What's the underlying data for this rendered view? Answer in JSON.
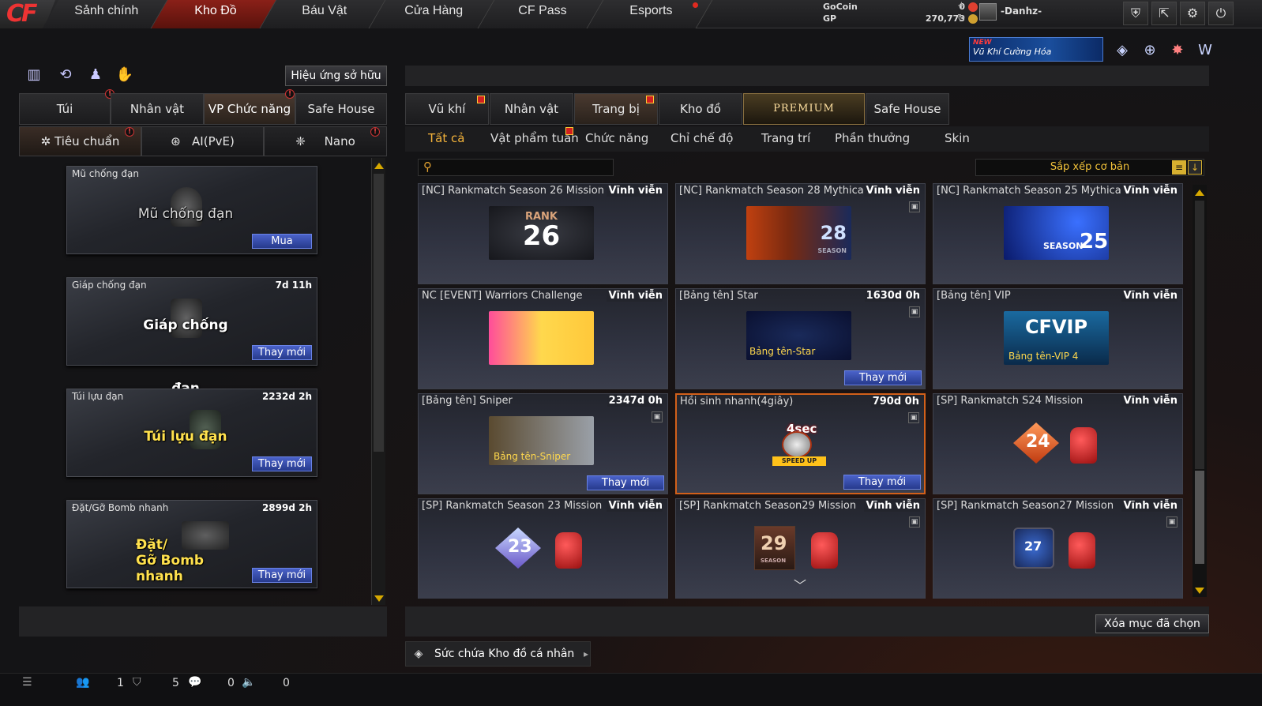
{
  "topnav": {
    "logo": "CF",
    "items": [
      "Sảnh chính",
      "Kho Đồ",
      "Báu Vật",
      "Cửa Hàng",
      "CF Pass",
      "Esports"
    ],
    "active_index": 1
  },
  "currency": {
    "gocoin_label": "GoCoin",
    "gocoin_value": "0",
    "gp_label": "GP",
    "gp_value": "270,773"
  },
  "user": {
    "name": "-Danhz-"
  },
  "promo": {
    "new": "NEW",
    "text": "Vũ Khí Cường Hóa"
  },
  "left": {
    "effect_button": "Hiệu ứng sở hữu",
    "tabs": [
      "Túi",
      "Nhân vật",
      "VP Chức năng",
      "Safe House"
    ],
    "active_tab": 2,
    "subtabs": [
      "Tiêu chuẩn",
      "AI(PvE)",
      "Nano"
    ],
    "cards": [
      {
        "name": "Mũ chống đạn",
        "time": "",
        "label": "Mũ chống đạn",
        "action": "Mua"
      },
      {
        "name": "Giáp chống đạn",
        "time": "7d 11h",
        "label": "Giáp chống đạn",
        "action": "Thay mới"
      },
      {
        "name": "Túi lựu đạn",
        "time": "2232d 2h",
        "label": "Túi lựu đạn",
        "action": "Thay mới"
      },
      {
        "name": "Đặt/Gỡ Bomb nhanh",
        "time": "2899d 2h",
        "label1": "Đặt/",
        "label2": "Gỡ Bomb nhanh",
        "action": "Thay mới"
      }
    ]
  },
  "right": {
    "tabs": [
      "Vũ khí",
      "Nhân vật",
      "Trang bị",
      "Kho đồ",
      "PREMIUM",
      "Safe House"
    ],
    "active_tab": 2,
    "categories": [
      "Tất cả",
      "Vật phẩm tuần",
      "Chức năng",
      "Chỉ chế độ",
      "Trang trí",
      "Phần thưởng",
      "Skin"
    ],
    "active_category": 0,
    "search_placeholder": "",
    "sort_label": "Sắp xếp cơ bản",
    "items": [
      {
        "name": "[NC] Rankmatch Season 26 Mission",
        "time": "Vĩnh viễn",
        "pic_top": "RANK",
        "pic_main": "26",
        "action": ""
      },
      {
        "name": "[NC] Rankmatch Season 28 Mythical",
        "time": "Vĩnh viễn",
        "pic_main": "28",
        "pic_sub": "SEASON",
        "action": ""
      },
      {
        "name": "[NC] Rankmatch Season 25 Mythical",
        "time": "Vĩnh viễn",
        "pic_top": "SEASON",
        "pic_main": "25",
        "action": ""
      },
      {
        "name": "NC [EVENT] Warriors Challenge",
        "time": "Vĩnh viễn",
        "action": ""
      },
      {
        "name": "[Bảng tên] Star",
        "time": "1630d 0h",
        "pic_label": "Bảng tên-Star",
        "action": "Thay mới"
      },
      {
        "name": "[Bảng tên] VIP",
        "time": "Vĩnh viễn",
        "pic_main": "CFVIP",
        "pic_label": "Bảng tên-VIP 4",
        "action": ""
      },
      {
        "name": "[Bảng tên] Sniper",
        "time": "2347d 0h",
        "pic_label": "Bảng tên-Sniper",
        "action": "Thay mới"
      },
      {
        "name": "Hồi sinh nhanh(4giây)",
        "time": "790d 0h",
        "pic_main": "4sec",
        "pic_sub": "SPEED UP",
        "action": "Thay mới"
      },
      {
        "name": "[SP] Rankmatch S24 Mission",
        "time": "Vĩnh viễn",
        "pic_main": "24",
        "action": ""
      },
      {
        "name": "[SP] Rankmatch Season 23 Mission",
        "time": "Vĩnh viễn",
        "pic_main": "23",
        "action": ""
      },
      {
        "name": "[SP] Rankmatch Season29 Mission",
        "time": "Vĩnh viễn",
        "pic_main": "29",
        "pic_sub": "SEASON",
        "action": ""
      },
      {
        "name": "[SP] Rankmatch Season27 Mission",
        "time": "Vĩnh viễn",
        "pic_main": "27",
        "action": ""
      }
    ],
    "delete_button": "Xóa mục đã chọn",
    "capacity_label": "Sức chứa Kho đồ cá nhân"
  },
  "statusbar": {
    "v1": "1",
    "v2": "5",
    "v3": "0",
    "v4": "0"
  },
  "colors": {
    "accent_red": "#8a2018",
    "action_blue": "#3a50b0",
    "category_active": "#f2b23a",
    "selected_border": "#d2601a"
  }
}
